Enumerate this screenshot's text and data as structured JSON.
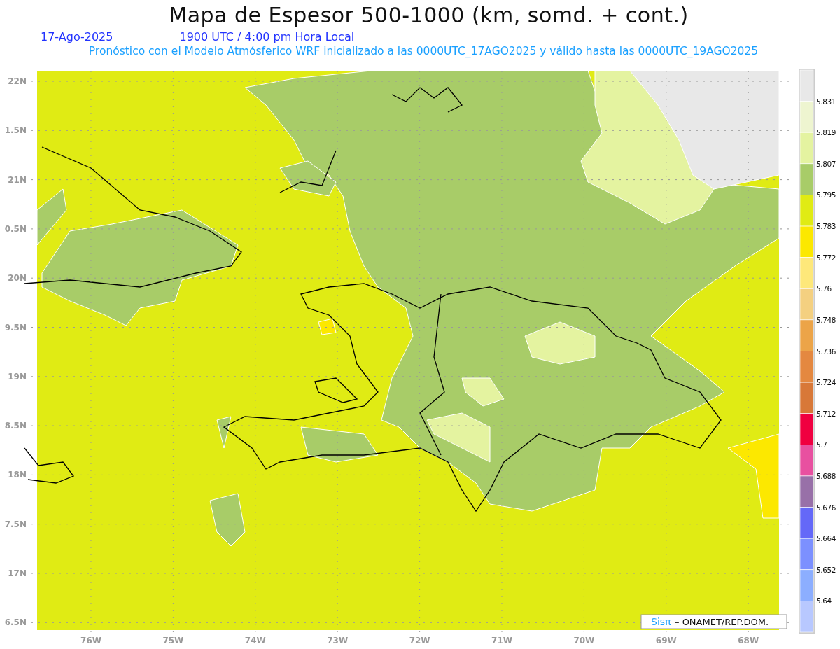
{
  "title": "Mapa de Espesor 500-1000 (km, somd. + cont.)",
  "date": "17-Ago-2025",
  "time": "1900 UTC / 4:00 pm Hora Local",
  "subtitle": "Pronóstico con el Modelo Atmósferico WRF inicializado a las 0000UTC_17AGO2025 y válido hasta las  0000UTC_19AGO2025",
  "map": {
    "y_labels": [
      "22N",
      "1.5N",
      "21N",
      "0.5N",
      "20N",
      "9.5N",
      "19N",
      "8.5N",
      "18N",
      "7.5N",
      "17N",
      "6.5N"
    ],
    "x_labels": [
      "76W",
      "75W",
      "74W",
      "73W",
      "72W",
      "71W",
      "70W",
      "69W",
      "68W"
    ]
  },
  "legend": {
    "bins": [
      {
        "color": "#e8e8e8"
      },
      {
        "color": "#eef5d0"
      },
      {
        "color": "#e4f3a0"
      },
      {
        "color": "#a8cc68"
      },
      {
        "color": "#e0eb14"
      },
      {
        "color": "#fce800"
      },
      {
        "color": "#fee87a"
      },
      {
        "color": "#f4d080"
      },
      {
        "color": "#eca448"
      },
      {
        "color": "#e48840"
      },
      {
        "color": "#d87838"
      },
      {
        "color": "#f00040"
      },
      {
        "color": "#e850a0"
      },
      {
        "color": "#9870a8"
      },
      {
        "color": "#6468f8"
      },
      {
        "color": "#7c90ff"
      },
      {
        "color": "#8caeff"
      },
      {
        "color": "#b8c8ff"
      }
    ],
    "labels": [
      "5.831",
      "5.819",
      "5.807",
      "5.795",
      "5.783",
      "5.772",
      "5.76",
      "5.748",
      "5.736",
      "5.724",
      "5.712",
      "5.7",
      "5.688",
      "5.676",
      "5.664",
      "5.652",
      "5.64"
    ]
  },
  "credit": {
    "logo": "Sisπ",
    "text": "– ONAMET/REP.DOM."
  }
}
